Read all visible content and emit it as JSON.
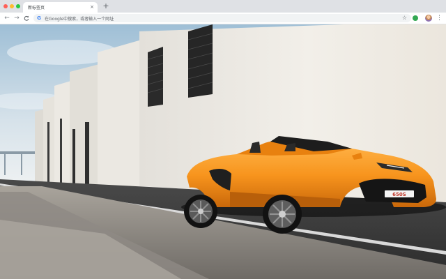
{
  "browser": {
    "tab_title": "新标签页",
    "tab_close": "×",
    "new_tab": "+",
    "nav_back": "←",
    "nav_forward": "→",
    "nav_reload": "C",
    "omnibox_icon": "G",
    "omnibox_placeholder": "在Google中搜索，或者输入一个网址",
    "bookmark_icon": "☆",
    "menu_icon": "⋮"
  },
  "wallpaper": {
    "car_badge": "650S",
    "colors": {
      "car": "#f7941d",
      "sky": "#b9d0df",
      "wall": "#ece8e1",
      "road": "#3a3a3a"
    }
  }
}
